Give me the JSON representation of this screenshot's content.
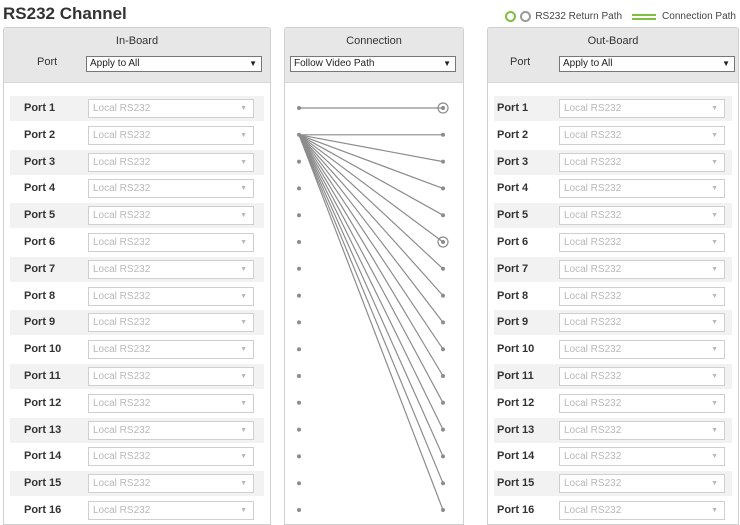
{
  "title": "RS232 Channel",
  "legend": {
    "return_path": "RS232 Return Path",
    "connection_path": "Connection Path"
  },
  "colors": {
    "accent_green": "#7fbf3f",
    "line_grey": "#8c8c8c"
  },
  "in_board": {
    "title": "In-Board",
    "port_header": "Port",
    "apply_value": "Apply to All"
  },
  "connection": {
    "title": "Connection",
    "mode_value": "Follow Video Path"
  },
  "out_board": {
    "title": "Out-Board",
    "port_header": "Port",
    "apply_value": "Apply to All"
  },
  "ports": [
    {
      "label": "Port 1",
      "in_value": "Local RS232",
      "out_value": "Local RS232"
    },
    {
      "label": "Port 2",
      "in_value": "Local RS232",
      "out_value": "Local RS232"
    },
    {
      "label": "Port 3",
      "in_value": "Local RS232",
      "out_value": "Local RS232"
    },
    {
      "label": "Port 4",
      "in_value": "Local RS232",
      "out_value": "Local RS232"
    },
    {
      "label": "Port 5",
      "in_value": "Local RS232",
      "out_value": "Local RS232"
    },
    {
      "label": "Port 6",
      "in_value": "Local RS232",
      "out_value": "Local RS232"
    },
    {
      "label": "Port 7",
      "in_value": "Local RS232",
      "out_value": "Local RS232"
    },
    {
      "label": "Port 8",
      "in_value": "Local RS232",
      "out_value": "Local RS232"
    },
    {
      "label": "Port 9",
      "in_value": "Local RS232",
      "out_value": "Local RS232"
    },
    {
      "label": "Port 10",
      "in_value": "Local RS232",
      "out_value": "Local RS232"
    },
    {
      "label": "Port 11",
      "in_value": "Local RS232",
      "out_value": "Local RS232"
    },
    {
      "label": "Port 12",
      "in_value": "Local RS232",
      "out_value": "Local RS232"
    },
    {
      "label": "Port 13",
      "in_value": "Local RS232",
      "out_value": "Local RS232"
    },
    {
      "label": "Port 14",
      "in_value": "Local RS232",
      "out_value": "Local RS232"
    },
    {
      "label": "Port 15",
      "in_value": "Local RS232",
      "out_value": "Local RS232"
    },
    {
      "label": "Port 16",
      "in_value": "Local RS232",
      "out_value": "Local RS232"
    }
  ],
  "connections": [
    {
      "from": 1,
      "to": 1
    },
    {
      "from": 2,
      "to": 2
    },
    {
      "from": 2,
      "to": 3
    },
    {
      "from": 2,
      "to": 4
    },
    {
      "from": 2,
      "to": 5
    },
    {
      "from": 2,
      "to": 6
    },
    {
      "from": 2,
      "to": 7
    },
    {
      "from": 2,
      "to": 8
    },
    {
      "from": 2,
      "to": 9
    },
    {
      "from": 2,
      "to": 10
    },
    {
      "from": 2,
      "to": 11
    },
    {
      "from": 2,
      "to": 12
    },
    {
      "from": 2,
      "to": 13
    },
    {
      "from": 2,
      "to": 14
    },
    {
      "from": 2,
      "to": 15
    },
    {
      "from": 2,
      "to": 16
    }
  ],
  "return_path_outputs": [
    1,
    6
  ]
}
